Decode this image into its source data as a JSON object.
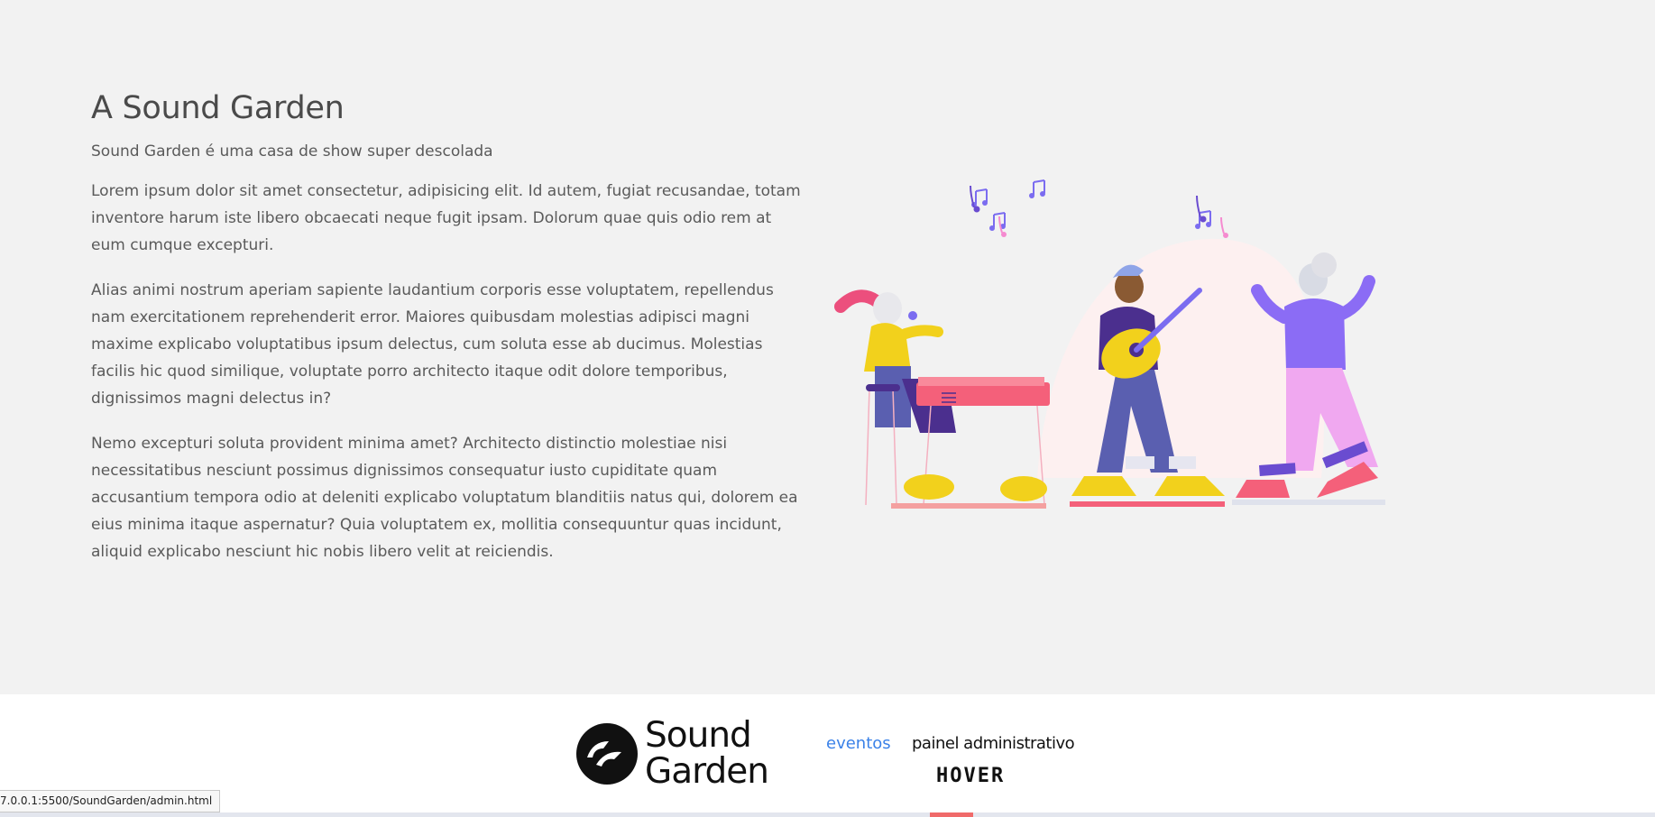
{
  "about": {
    "title": "A Sound Garden",
    "subtitle": "Sound Garden é uma casa de show super descolada",
    "paragraphs": [
      "Lorem ipsum dolor sit amet consectetur, adipisicing elit. Id autem, fugiat recusandae, totam inventore harum iste libero obcaecati neque fugit ipsam. Dolorum quae quis odio rem at eum cumque excepturi.",
      "Alias animi nostrum aperiam sapiente laudantium corporis esse voluptatem, repellendus nam exercitationem reprehenderit error. Maiores quibusdam molestias adipisci magni maxime explicabo voluptatibus ipsum delectus, cum soluta esse ab ducimus. Molestias facilis hic quod similique, voluptate porro architecto itaque odit dolore temporibus, dignissimos magni delectus in?",
      "Nemo excepturi soluta provident minima amet? Architecto distinctio molestiae nisi necessitatibus nesciunt possimus dignissimos consequatur iusto cupiditate quam accusantium tempora odio at deleniti explicabo voluptatum blanditiis natus qui, dolorem ea eius minima itaque aspernatur? Quia voluptatem ex, mollitia consequuntur quas incidunt, aliquid explicabo nesciunt hic nobis libero velit at reiciendis."
    ]
  },
  "illustration": {
    "icon": "band-playing-illustration"
  },
  "footer": {
    "logo_line1": "Sound",
    "logo_line2": "Garden",
    "nav_eventos": "eventos",
    "nav_admin": "painel administrativo",
    "hover_text": "HOVER"
  },
  "status_bar": {
    "url": "7.0.0.1:5500/SoundGarden/admin.html"
  },
  "colors": {
    "link": "#3b82e8",
    "background": "#f2f2f2",
    "footer": "#ffffff"
  }
}
